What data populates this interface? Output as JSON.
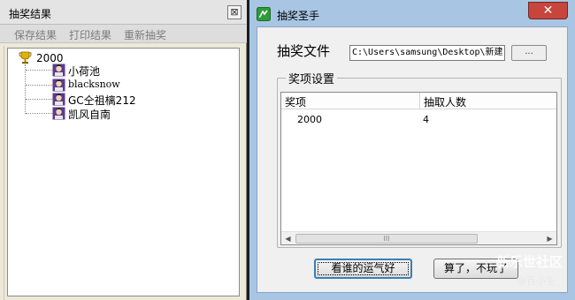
{
  "left_window": {
    "title": "抽奖结果",
    "close_glyph": "⊠",
    "toolbar": {
      "save_label": "保存结果",
      "print_label": "打印结果",
      "redraw_label": "重新抽奖"
    },
    "tree": {
      "root_label": "2000",
      "root_icon": "trophy-icon",
      "winners": [
        "小荷池",
        "blacksnow",
        "GC仝祖樆212",
        "凯风自南"
      ],
      "winner_icon": "winner-avatar-icon"
    }
  },
  "right_window": {
    "title": "抽奖圣手",
    "close_glyph": "✕",
    "file_label": "抽奖文件",
    "file_path": "C:\\Users\\samsung\\Desktop\\新建",
    "browse_label": "...",
    "group_title": "奖项设置",
    "columns": [
      "奖项",
      "抽取人数"
    ],
    "rows": [
      [
        "2000",
        "4"
      ]
    ],
    "scroll_left": "◀",
    "scroll_right": "▶",
    "scroll_thumb": "III",
    "lucky_button": "看谁的运气好",
    "quit_button": "算了，不玩了"
  },
  "watermark": {
    "main": "新乐世社区",
    "sub": "@百小生"
  },
  "colors": {
    "title_bar_blue": "#a8c6e4",
    "close_red": "#c7453b",
    "toolbar_gray": "#dddddd"
  }
}
